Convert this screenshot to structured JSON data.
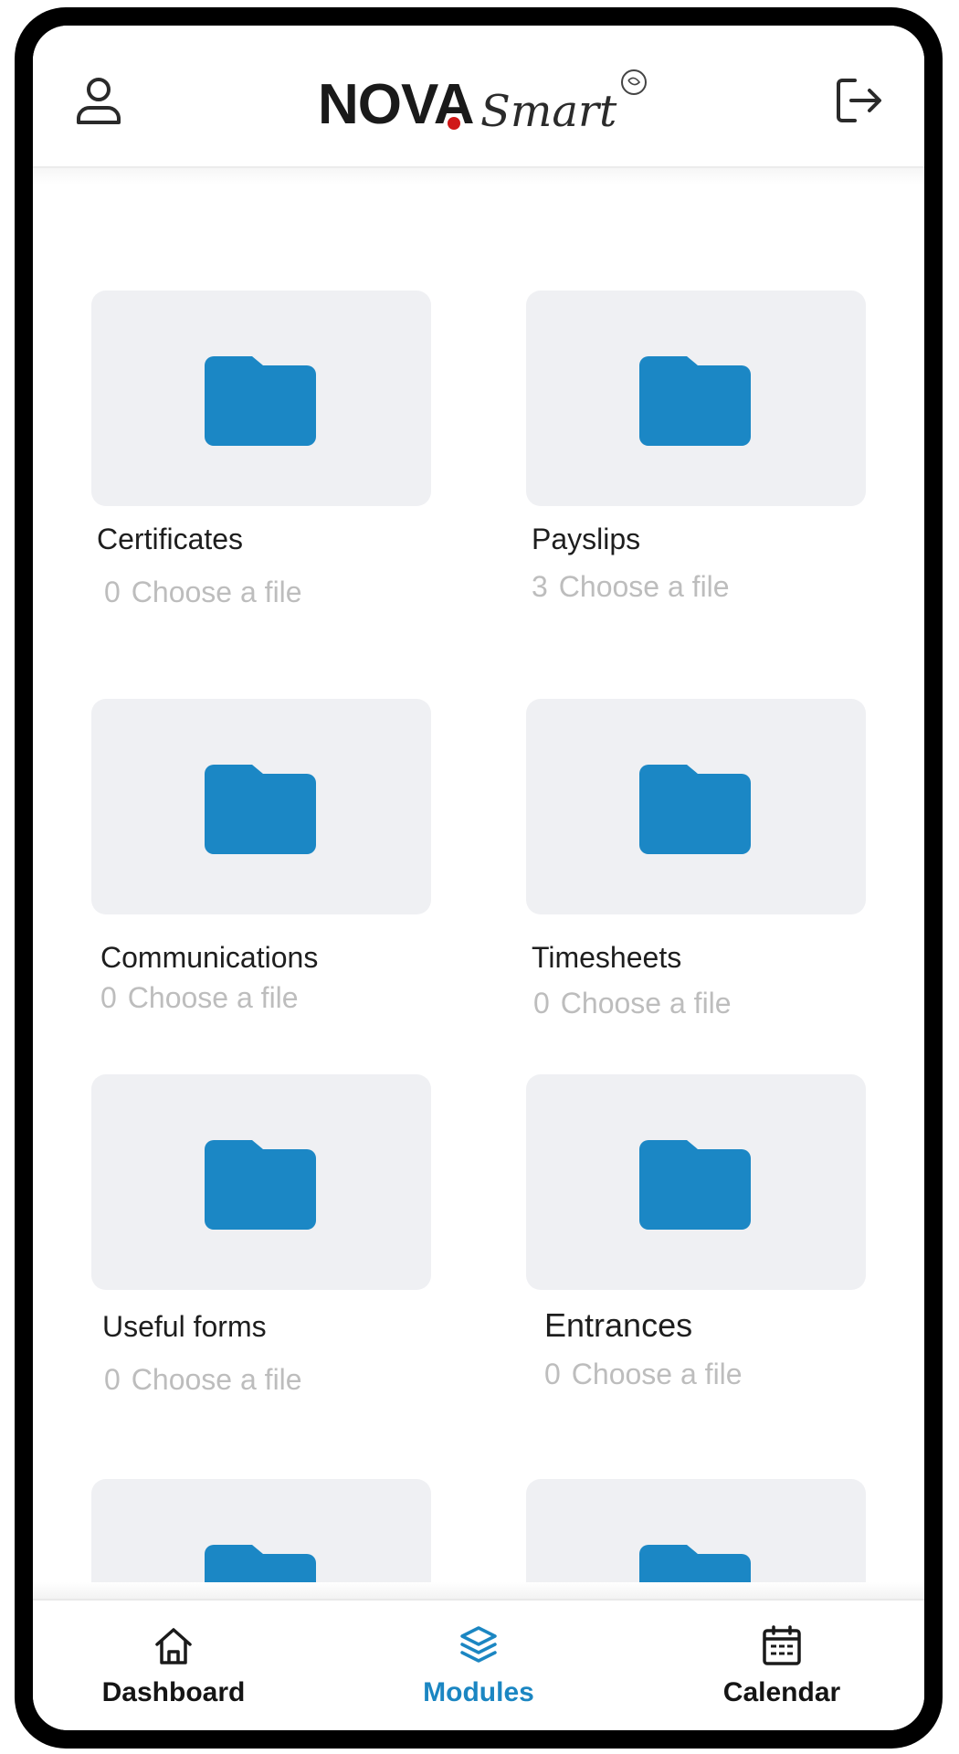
{
  "header": {
    "logo_primary": "NOVA",
    "logo_secondary": "Smart",
    "profile_icon": "user-icon",
    "logout_icon": "logout-icon"
  },
  "colors": {
    "accent": "#1b86c2",
    "folder": "#1b87c5",
    "card_bg": "#eff0f3",
    "subtext": "#bdbdbd"
  },
  "folders": [
    {
      "title": "Certificates",
      "count": "0",
      "action": "Choose a file",
      "icon": "folder-icon"
    },
    {
      "title": "Payslips",
      "count": "3",
      "action": "Choose a file",
      "icon": "folder-icon"
    },
    {
      "title": "Communications",
      "count": "0",
      "action": "Choose a file",
      "icon": "folder-icon"
    },
    {
      "title": "Timesheets",
      "count": "0",
      "action": "Choose a file",
      "icon": "folder-icon"
    },
    {
      "title": "Useful forms",
      "count": "0",
      "action": "Choose a file",
      "icon": "folder-icon"
    },
    {
      "title": "Entrances",
      "count": "0",
      "action": "Choose a file",
      "icon": "folder-icon"
    }
  ],
  "bottom_nav": [
    {
      "label": "Dashboard",
      "icon": "home-icon",
      "active": false
    },
    {
      "label": "Modules",
      "icon": "layers-icon",
      "active": true
    },
    {
      "label": "Calendar",
      "icon": "calendar-icon",
      "active": false
    }
  ]
}
